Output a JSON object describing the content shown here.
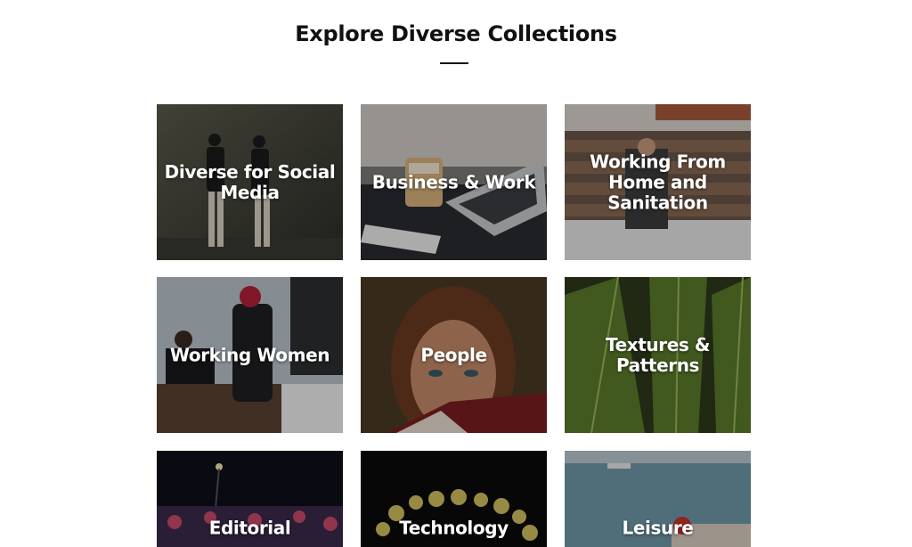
{
  "section": {
    "title": "Explore Diverse Collections"
  },
  "collections": [
    {
      "label": "Diverse for Social Media",
      "icon": "photo-people-walking"
    },
    {
      "label": "Business & Work",
      "icon": "photo-laptop-coffee"
    },
    {
      "label": "Working From Home and Sanitation",
      "icon": "photo-grocery-store"
    },
    {
      "label": "Working Women",
      "icon": "photo-women-office"
    },
    {
      "label": "People",
      "icon": "photo-woman-portrait"
    },
    {
      "label": "Textures & Patterns",
      "icon": "photo-green-leaf"
    },
    {
      "label": "Editorial",
      "icon": "photo-night-crowd"
    },
    {
      "label": "Technology",
      "icon": "photo-bokeh-lights"
    },
    {
      "label": "Leisure",
      "icon": "photo-sea-boat"
    }
  ],
  "colors": {
    "title": "#111111",
    "background": "#ffffff",
    "label": "#ffffff"
  }
}
